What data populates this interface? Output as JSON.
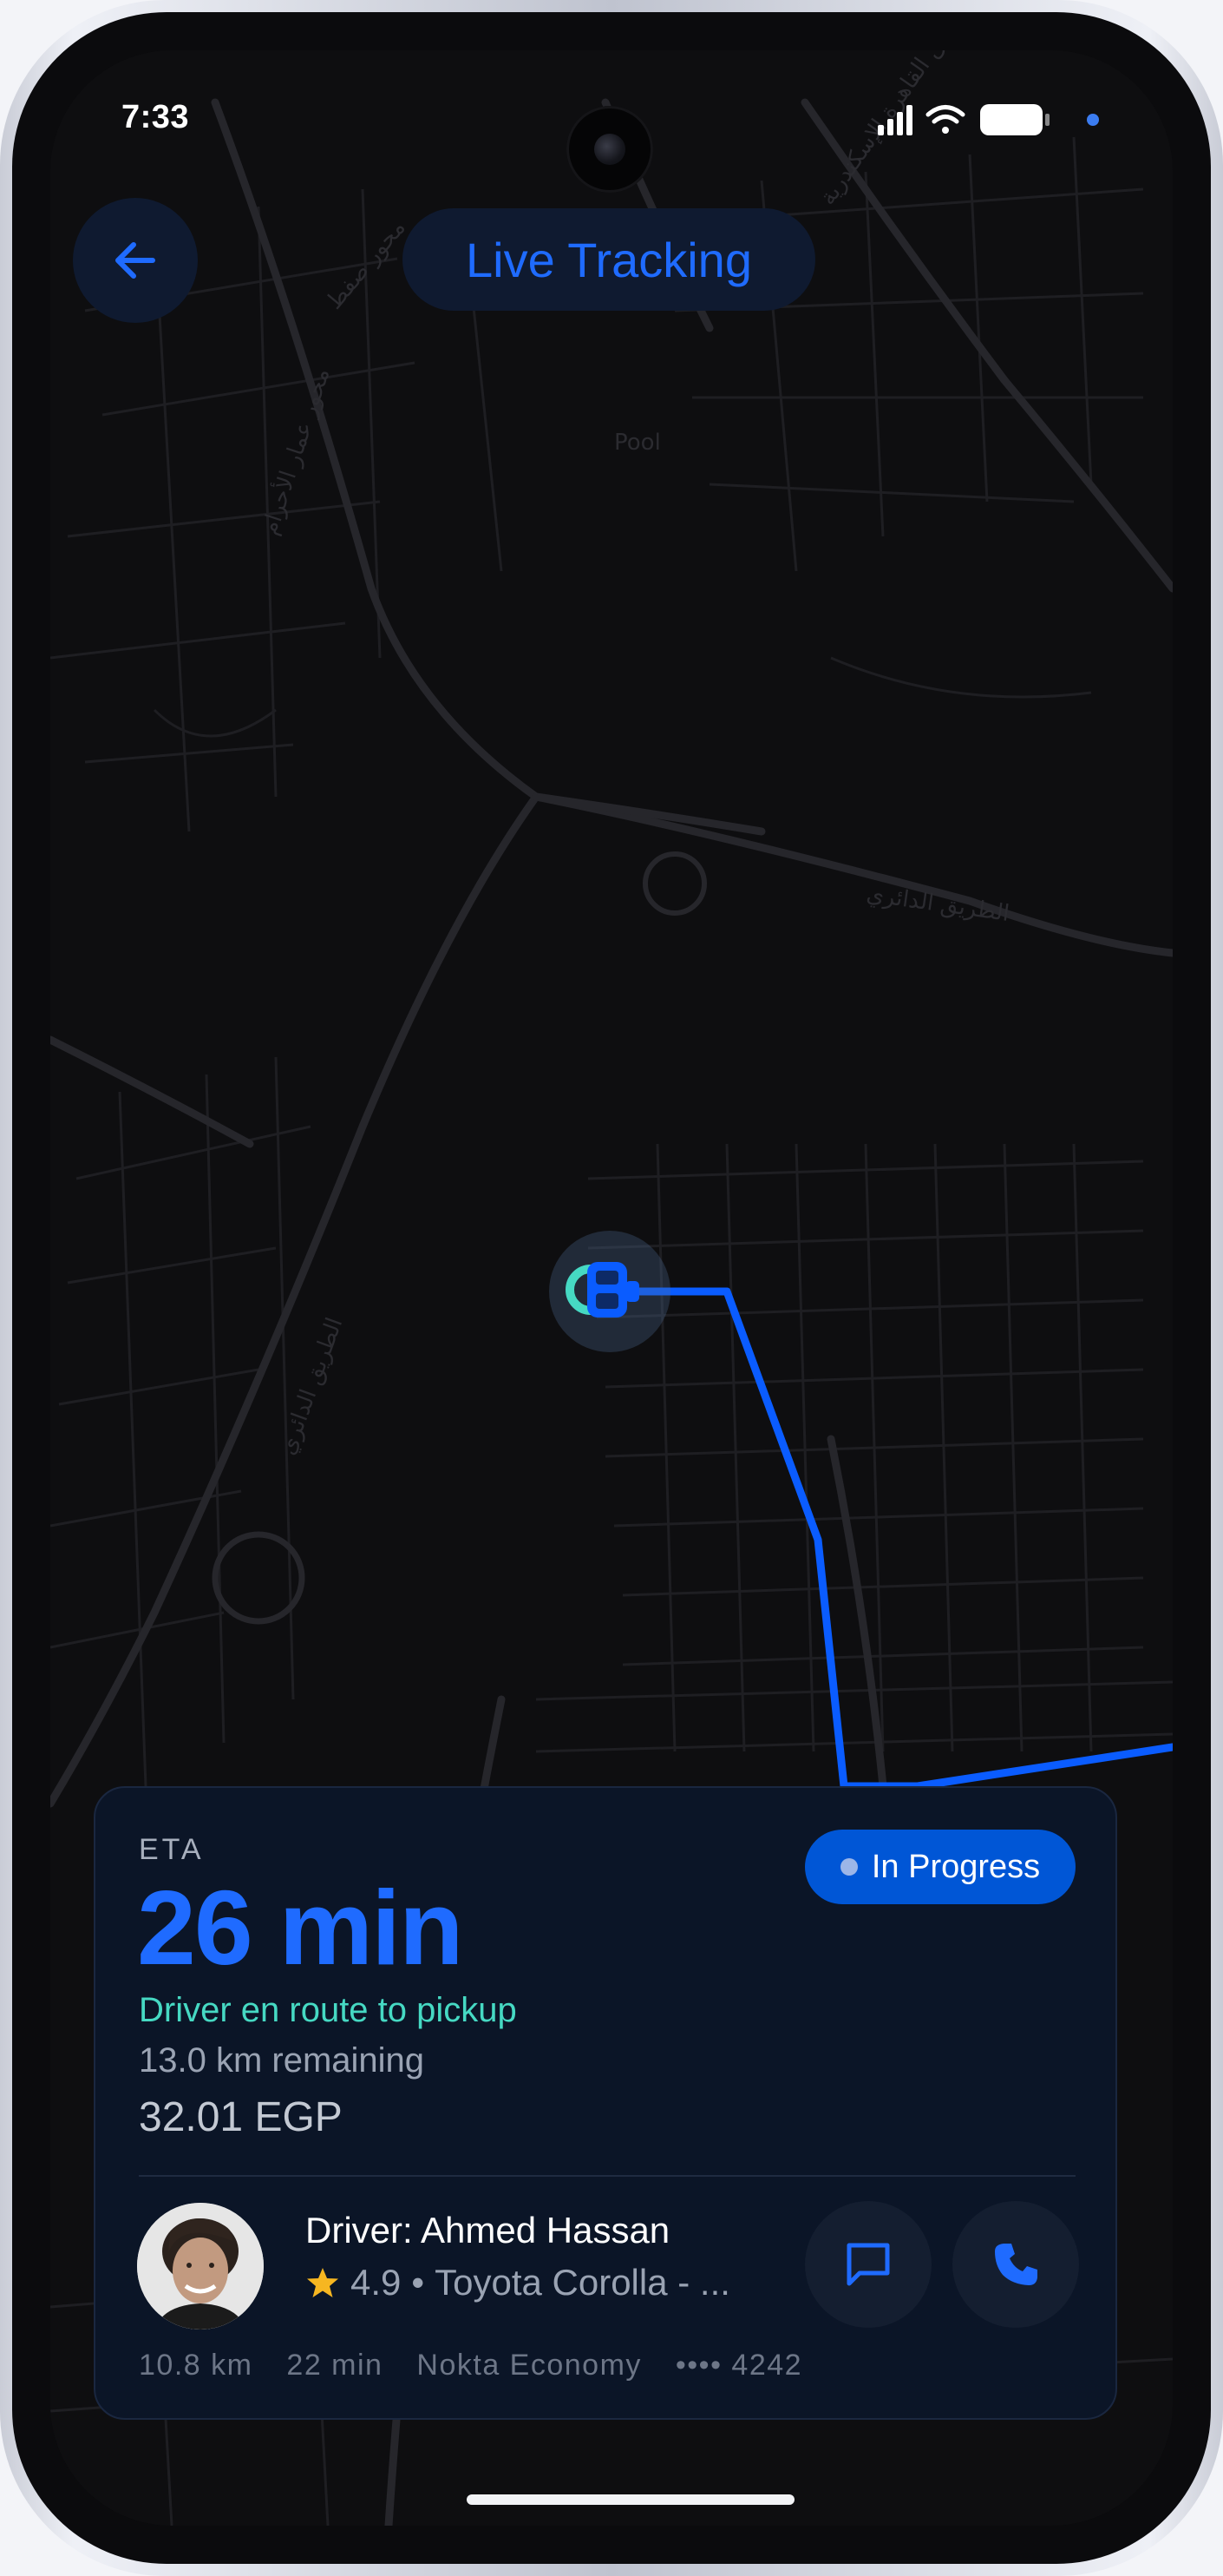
{
  "status_bar": {
    "time": "7:33"
  },
  "header": {
    "title": "Live Tracking",
    "back_icon": "arrow-left-icon"
  },
  "map": {
    "route_color": "#0a5cff",
    "marker_color": "#46d9c3",
    "street_labels": [
      "الطريق الدائري",
      "الطريق الدائري",
      "طريق القاهرة الإسكندرية",
      "محور صفط",
      "محور عمار الأحرام",
      "Pool"
    ]
  },
  "trip_card": {
    "eta_label": "ETA",
    "eta_value": "26 min",
    "status_text": "Driver en route to pickup",
    "distance_remaining": "13.0 km remaining",
    "fare": "32.01 EGP",
    "badge": "In Progress",
    "driver": {
      "name": "Driver: Ahmed Hassan",
      "rating": "4.9",
      "separator": "•",
      "vehicle": "Toyota Corolla - ..."
    },
    "meta": [
      "10.8 km",
      "22 min",
      "Nokta Economy",
      "•••• 4242"
    ],
    "chat_icon": "chat-bubble-icon",
    "call_icon": "phone-icon",
    "colors": {
      "accent": "#1f6bff",
      "teal": "#46d9c3",
      "badge_bg": "#0056d6",
      "card_bg": "#0b1527"
    }
  }
}
